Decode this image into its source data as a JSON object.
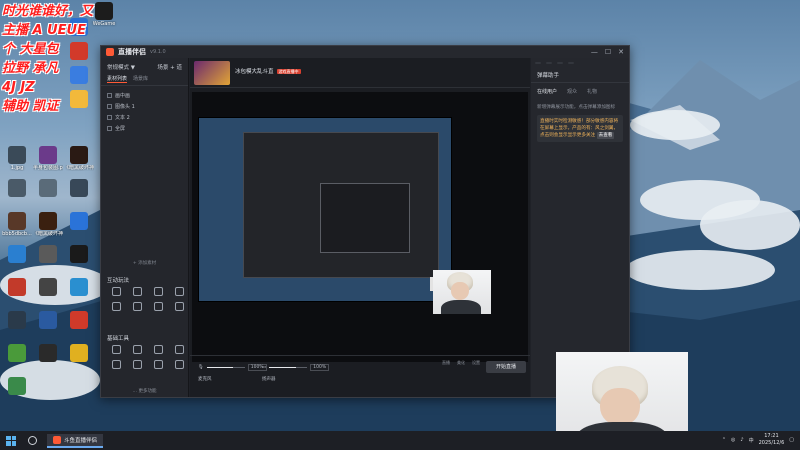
{
  "overlay": {
    "lines": [
      "时光谁谁好，又",
      "主播 A UEUE",
      "个 大星包",
      "拉野  承凡",
      "4J JZ",
      "辅助  凯证"
    ]
  },
  "desktop_icons": [
    {
      "label": "WeGame",
      "color": "#1c1c1c"
    },
    {
      "label": "",
      "color": "#2a6fd1"
    },
    {
      "label": "",
      "color": "#d23a2a"
    },
    {
      "label": "",
      "color": "#3a7de0"
    },
    {
      "label": "",
      "color": "#f2b93b"
    },
    {
      "label": "1.jpg",
      "color": "#3a4a58"
    },
    {
      "label": "半身包装图.png",
      "color": "#6b3a8a"
    },
    {
      "label": "《暗黑破坏神 IV》",
      "color": "#2a1a14"
    },
    {
      "label": "",
      "color": "#4a5a68"
    },
    {
      "label": "",
      "color": "#5a6b79"
    },
    {
      "label": "",
      "color": "#384858"
    },
    {
      "label": "bbb5dbcb...",
      "color": "#583828"
    },
    {
      "label": "《暗黑破坏神 II》",
      "color": "#3a2010"
    },
    {
      "label": "",
      "color": "#2a73d8"
    },
    {
      "label": "",
      "color": "#2a7fd0"
    },
    {
      "label": "",
      "color": "#5a5a5a"
    },
    {
      "label": "",
      "color": "#1a1a1a"
    },
    {
      "label": "",
      "color": "#c23a2a"
    },
    {
      "label": "",
      "color": "#444"
    },
    {
      "label": "",
      "color": "#2a8fd0"
    },
    {
      "label": "",
      "color": "#2a3a4a"
    },
    {
      "label": "",
      "color": "#2a5aa0"
    },
    {
      "label": "",
      "color": "#d03a2a"
    },
    {
      "label": "",
      "color": "#4a9a3a"
    },
    {
      "label": "",
      "color": "#2a2a2a"
    },
    {
      "label": "",
      "color": "#e0b020"
    },
    {
      "label": "",
      "color": "#3a8a4a"
    }
  ],
  "app": {
    "title": "直播伴侣",
    "version": "v9.1.0",
    "window_buttons": [
      "—",
      "☐",
      "✕"
    ],
    "left": {
      "scene_header": "常规模式 ▼",
      "scene_header_right": "场景 + 道",
      "tabs": [
        "素材列表",
        "场景库"
      ],
      "items": [
        "画中画",
        "图像头 1",
        "文本 2",
        "全屏"
      ],
      "add_label": "+ 添加素材",
      "section_interact": "互动玩法",
      "interact_tools": [
        "",
        "",
        "",
        "",
        "",
        "",
        "",
        ""
      ],
      "section_basic": "基础工具",
      "basic_tools": [
        "",
        "",
        "",
        "",
        "",
        "",
        "",
        ""
      ],
      "more": "… 更多功能"
    },
    "center": {
      "stream_title": "冰包模大乱斗直",
      "badge": "游戏直播中",
      "sub": "",
      "right_top": "",
      "right_sub": ""
    },
    "bottom": {
      "mic_label": "麦克风",
      "mic_pct": "100%",
      "mic_level": 0.7,
      "spk_label": "扬声器",
      "spk_pct": "100%",
      "spk_level": 0.7,
      "tools": [
        "直播",
        "美化",
        "设置"
      ],
      "start_label": "开始直播",
      "status": ""
    },
    "right": {
      "top_buttons": [
        "",
        "",
        "",
        ""
      ],
      "header": "弹幕助手",
      "tabs": [
        "在线用户",
        "观众",
        "礼物"
      ],
      "messages": [
        "",
        "",
        "",
        "新增弹幕展示功能，点击弹幕添加图标",
        "直播时实时检测敏感！部分敏感内容将在屏幕上显示，产品的有：风之剑翼，点击则会显示显示更多关注",
        "去查看"
      ]
    }
  },
  "taskbar": {
    "app_label": "斗鱼直播伴侣",
    "time": "17:21",
    "date": "2025/12/6"
  }
}
